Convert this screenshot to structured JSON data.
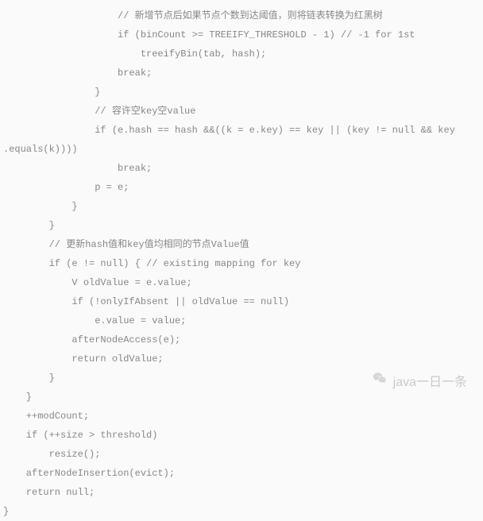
{
  "code": {
    "lines": [
      "                    // 新增节点后如果节点个数到达阈值，则将链表转换为红黑树",
      "                    if (binCount >= TREEIFY_THRESHOLD - 1) // -1 for 1st",
      "                        treeifyBin(tab, hash);",
      "                    break;",
      "                }",
      "                // 容许空key空value",
      "                if (e.hash == hash &&((k = e.key) == key || (key != null && key",
      ".equals(k))))",
      "                    break;",
      "                p = e;",
      "            }",
      "        }",
      "        // 更新hash值和key值均相同的节点Value值",
      "        if (e != null) { // existing mapping for key",
      "            V oldValue = e.value;",
      "            if (!onlyIfAbsent || oldValue == null)",
      "                e.value = value;",
      "            afterNodeAccess(e);",
      "            return oldValue;",
      "        }",
      "    }",
      "    ++modCount;",
      "    if (++size > threshold)",
      "        resize();",
      "    afterNodeInsertion(evict);",
      "    return null;",
      "}"
    ]
  },
  "watermark": {
    "text": "java一日一条"
  }
}
